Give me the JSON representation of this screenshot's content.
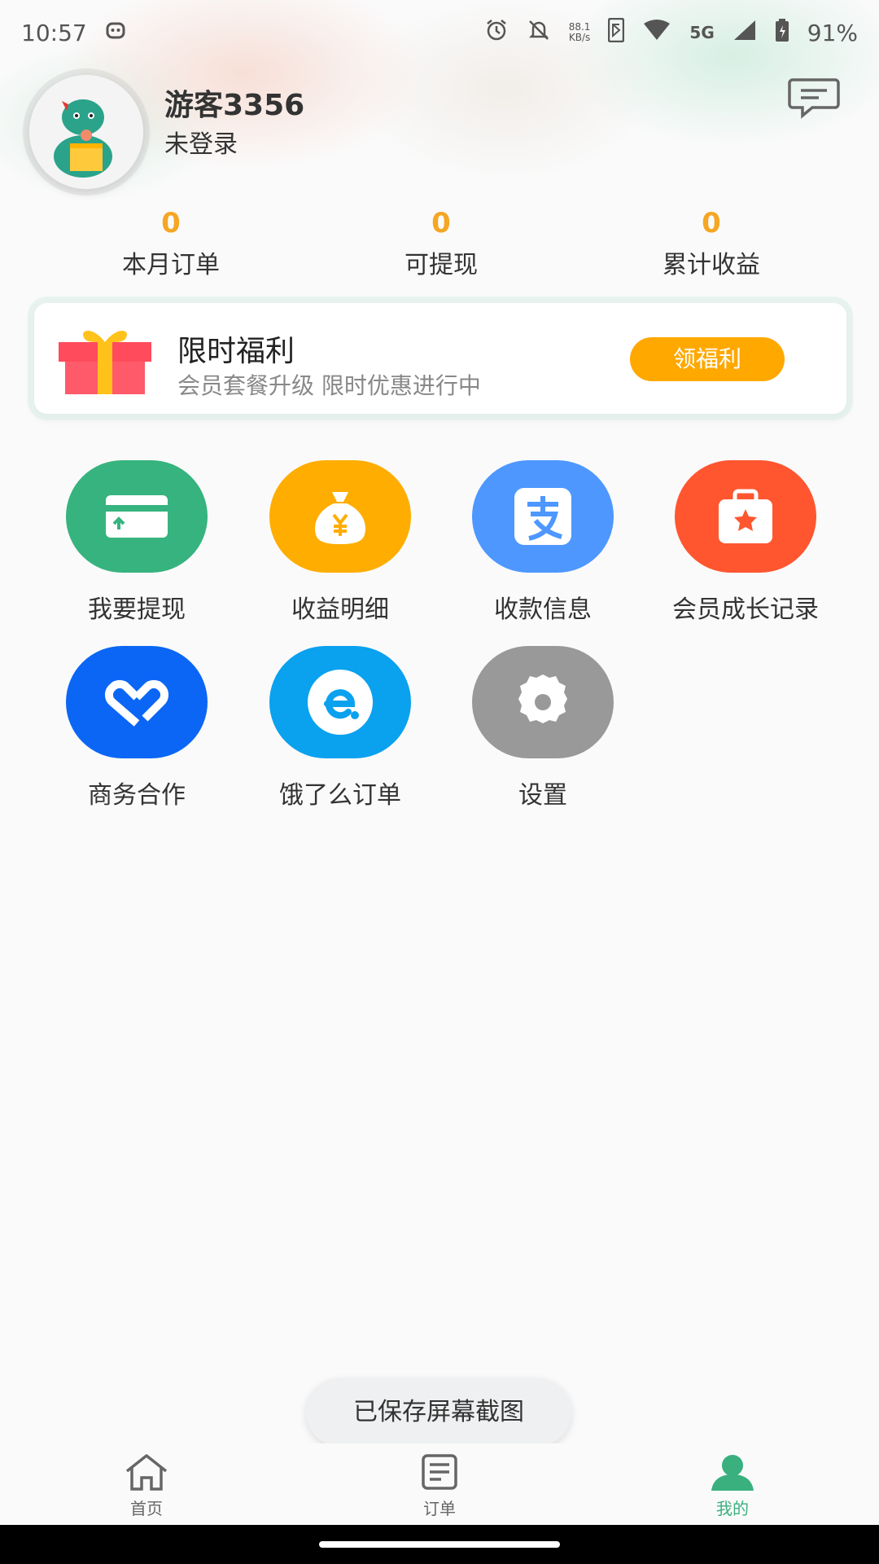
{
  "status_bar": {
    "time": "10:57",
    "net_speed_value": "88.1",
    "net_speed_unit": "KB/s",
    "network": "5G",
    "battery": "91%",
    "icons": [
      "app-notification-icon",
      "alarm-icon",
      "bell-off-icon",
      "bluetooth-icon",
      "wifi-icon",
      "signal-icon",
      "battery-icon"
    ]
  },
  "profile": {
    "username": "游客3356",
    "login_status": "未登录",
    "avatar_icon": "dinosaur-avatar-icon",
    "message_icon": "message-icon"
  },
  "stats": [
    {
      "value": "0",
      "label": "本月订单"
    },
    {
      "value": "0",
      "label": "可提现"
    },
    {
      "value": "0",
      "label": "累计收益"
    }
  ],
  "promo": {
    "title": "限时福利",
    "subtitle": "会员套餐升级 限时优惠进行中",
    "button": "领福利",
    "icon": "gift-icon",
    "button_color": "#ffa800"
  },
  "grid": [
    {
      "label": "我要提现",
      "icon": "withdraw-card-icon",
      "color": "#36b37e"
    },
    {
      "label": "收益明细",
      "icon": "money-bag-icon",
      "color": "#ffad00"
    },
    {
      "label": "收款信息",
      "icon": "alipay-icon",
      "color": "#4d97ff"
    },
    {
      "label": "会员成长记录",
      "icon": "star-badge-icon",
      "color": "#ff5630"
    },
    {
      "label": "商务合作",
      "icon": "handshake-icon",
      "color": "#0b66f5"
    },
    {
      "label": "饿了么订单",
      "icon": "eleme-icon",
      "color": "#0aa1ef"
    },
    {
      "label": "设置",
      "icon": "gear-icon",
      "color": "#999999"
    }
  ],
  "toast": "已保存屏幕截图",
  "nav": [
    {
      "label": "首页",
      "icon": "home-icon"
    },
    {
      "label": "订单",
      "icon": "order-list-icon"
    },
    {
      "label": "我的",
      "icon": "profile-icon",
      "active": true
    }
  ],
  "colors": {
    "accent": "#3ab07f",
    "stat_number": "#f5a623"
  }
}
